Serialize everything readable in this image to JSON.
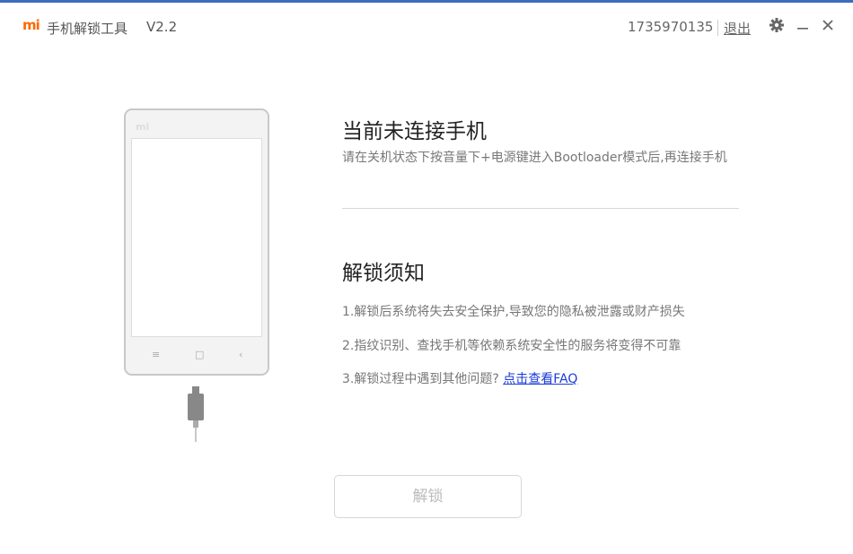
{
  "titlebar": {
    "logo_text": "mi",
    "app_title": "手机解锁工具",
    "version": "V2.2",
    "account_id": "1735970135",
    "logout_label": "退出",
    "icons": [
      "gear-icon",
      "minimize-icon",
      "close-icon"
    ]
  },
  "phone": {
    "brand": "mi",
    "nav_menu": "≡",
    "nav_home": "□",
    "nav_back": "‹"
  },
  "status": {
    "title": "当前未连接手机",
    "description": "请在关机状态下按音量下+电源键进入Bootloader模式后,再连接手机"
  },
  "notice": {
    "title": "解锁须知",
    "items": [
      {
        "text": "1.解锁后系统将失去安全保护,导致您的隐私被泄露或财产损失"
      },
      {
        "text": "2.指纹识别、查找手机等依赖系统安全性的服务将变得不可靠"
      },
      {
        "text": "3.解锁过程中遇到其他问题?",
        "link": "点击查看FAQ"
      }
    ]
  },
  "actions": {
    "unlock_label": "解锁",
    "unlock_enabled": false
  },
  "colors": {
    "brand": "#ff6700",
    "link": "#1b3bd7",
    "title_border": "#3b6dc0"
  }
}
